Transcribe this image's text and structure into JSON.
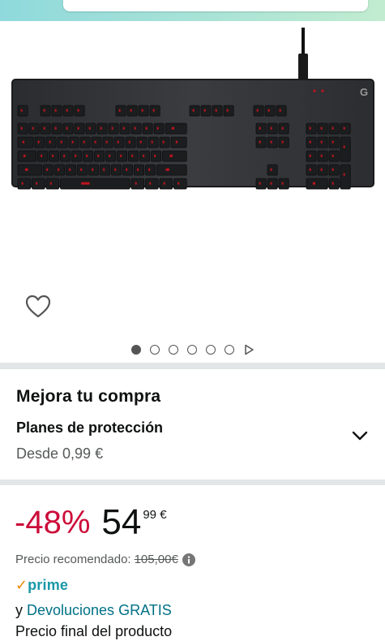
{
  "product": {
    "image_alt": "keyboard-image"
  },
  "carousel": {
    "count": 6,
    "active_index": 0
  },
  "upgrade": {
    "title": "Mejora tu compra",
    "plan_label": "Planes de protección",
    "plan_price": "Desde 0,99 €"
  },
  "price": {
    "discount": "-48%",
    "whole": "54",
    "fraction": "99 €",
    "recommended_label": "Precio recomendado:",
    "recommended_value": "105,00€"
  },
  "prime": {
    "check": "✓",
    "word": "prime"
  },
  "returns": {
    "prefix": "y",
    "link": "Devoluciones GRATIS"
  },
  "final_price_note": "Precio final del producto",
  "colors": {
    "discount": "#cc0c39",
    "link": "#007185",
    "prime_blue": "#1a98a8",
    "prime_orange": "#f08804",
    "key_light": "#c0141e"
  }
}
